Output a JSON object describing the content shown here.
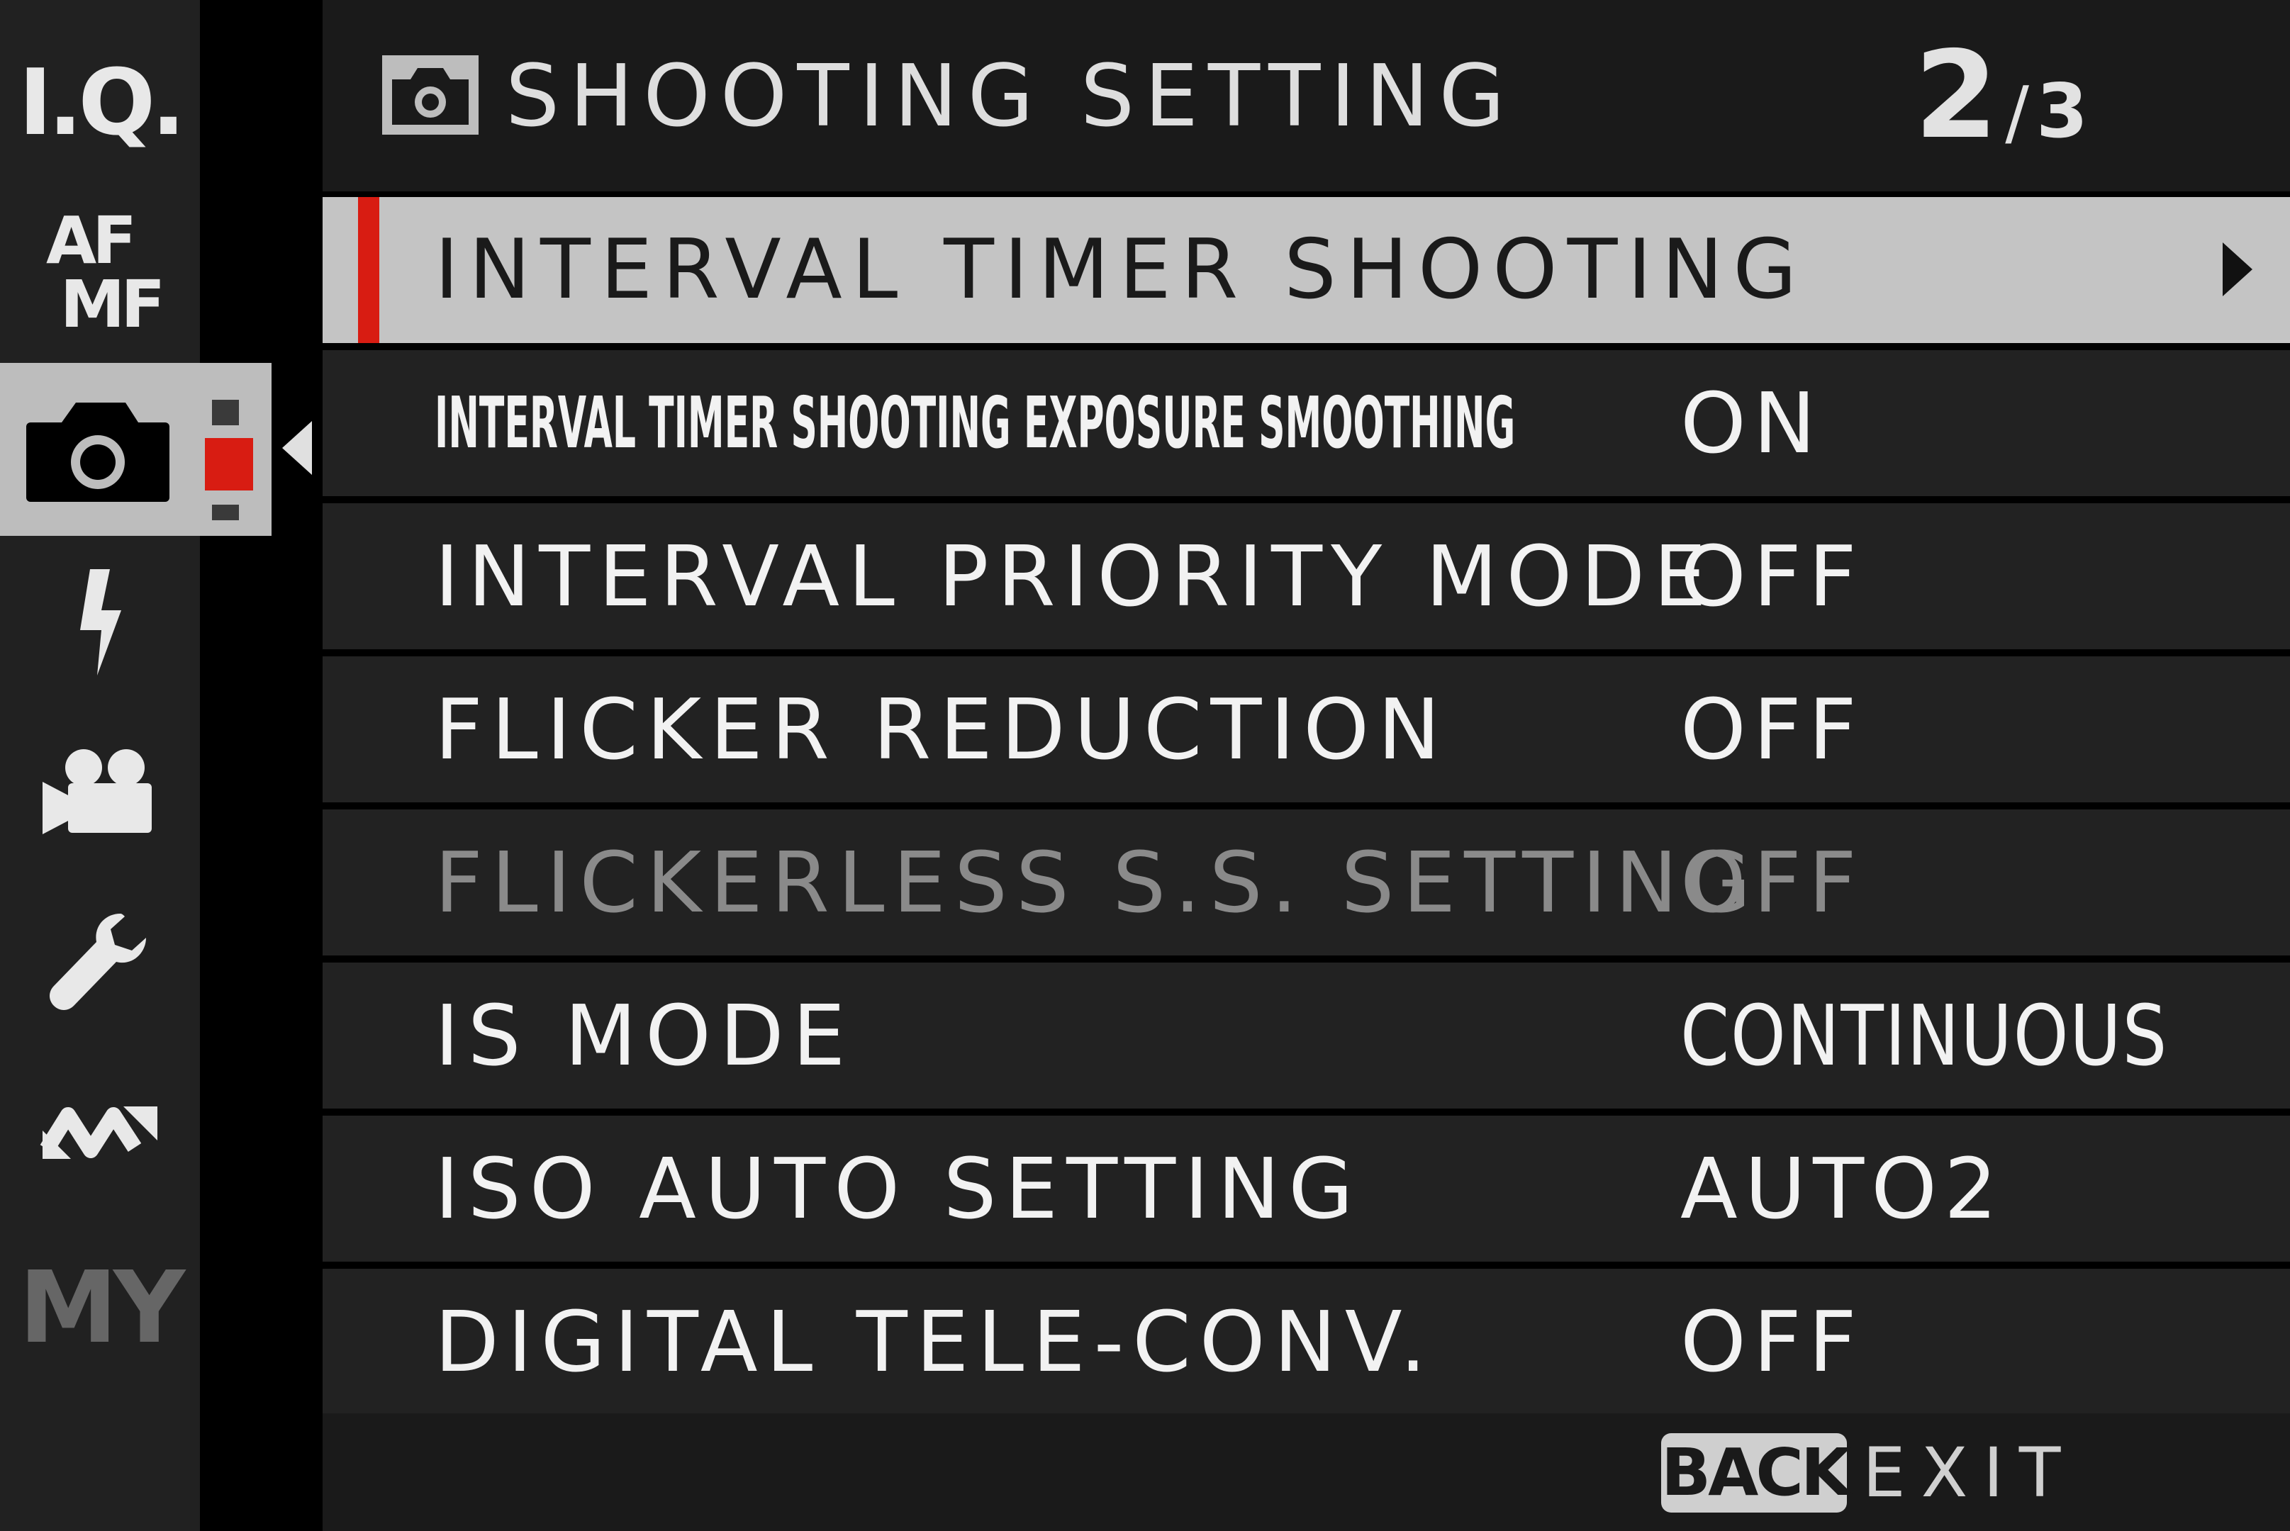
{
  "sidebar": {
    "items": [
      {
        "id": "iq",
        "label": "I.Q."
      },
      {
        "id": "af-mf",
        "label_top": "AF",
        "label_bottom": "MF"
      },
      {
        "id": "shooting",
        "icon": "camera-icon",
        "active": true
      },
      {
        "id": "flash",
        "icon": "flash-icon"
      },
      {
        "id": "movie",
        "icon": "movie-camera-icon"
      },
      {
        "id": "setup",
        "icon": "wrench-icon"
      },
      {
        "id": "connection",
        "icon": "connection-icon"
      },
      {
        "id": "my",
        "label": "MY"
      }
    ]
  },
  "header": {
    "icon": "camera-icon",
    "title": "SHOOTING SETTING",
    "page_current": "2",
    "page_separator": "/",
    "page_total": "3"
  },
  "menu": {
    "items": [
      {
        "label": "INTERVAL TIMER SHOOTING",
        "value": "",
        "selected": true
      },
      {
        "label": "INTERVAL TIMER SHOOTING EXPOSURE SMOOTHING",
        "value": "ON"
      },
      {
        "label": "INTERVAL PRIORITY MODE",
        "value": "OFF"
      },
      {
        "label": "FLICKER REDUCTION",
        "value": "OFF"
      },
      {
        "label": "FLICKERLESS S.S. SETTING",
        "value": "OFF",
        "disabled": true
      },
      {
        "label": "IS MODE",
        "value": "CONTINUOUS"
      },
      {
        "label": "ISO AUTO SETTING",
        "value": "AUTO2"
      },
      {
        "label": "DIGITAL TELE-CONV.",
        "value": "OFF"
      }
    ]
  },
  "footer": {
    "back_label": "BACK",
    "exit_label": "EXIT"
  },
  "colors": {
    "accent": "#d81c12",
    "selected_row": "#c4c4c4",
    "row": "#222222",
    "disabled_text": "#8a8a8a"
  }
}
